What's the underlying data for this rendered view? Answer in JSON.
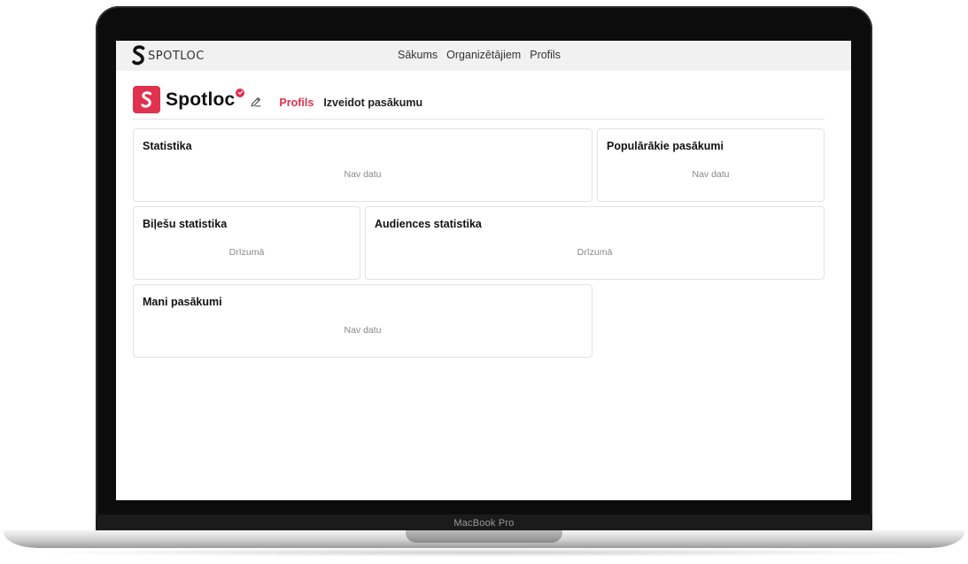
{
  "device_label": "MacBook Pro",
  "navbar": {
    "logo_text": "SPOTLOC",
    "links": [
      "Sākums",
      "Organizētājiem",
      "Profils"
    ]
  },
  "profile": {
    "name": "Spotloc",
    "tabs": [
      "Profils",
      "Izveidot pasākumu"
    ],
    "active_tab": "Profils"
  },
  "cards": {
    "statistika": {
      "title": "Statistika",
      "empty": "Nav datu"
    },
    "popularakie": {
      "title": "Populārākie pasākumi",
      "empty": "Nav datu"
    },
    "bilesu": {
      "title": "Biļešu statistika",
      "empty": "Drīzumā"
    },
    "audiences": {
      "title": "Audiences statistika",
      "empty": "Drīzumā"
    },
    "mani": {
      "title": "Mani pasākumi",
      "empty": "Nav datu"
    }
  },
  "colors": {
    "accent": "#e0314f",
    "navbar_bg": "#f1f1f1",
    "border": "#e3e3e3"
  },
  "icons": [
    "spotloc-logo-icon",
    "verified-badge-icon",
    "edit-icon"
  ]
}
